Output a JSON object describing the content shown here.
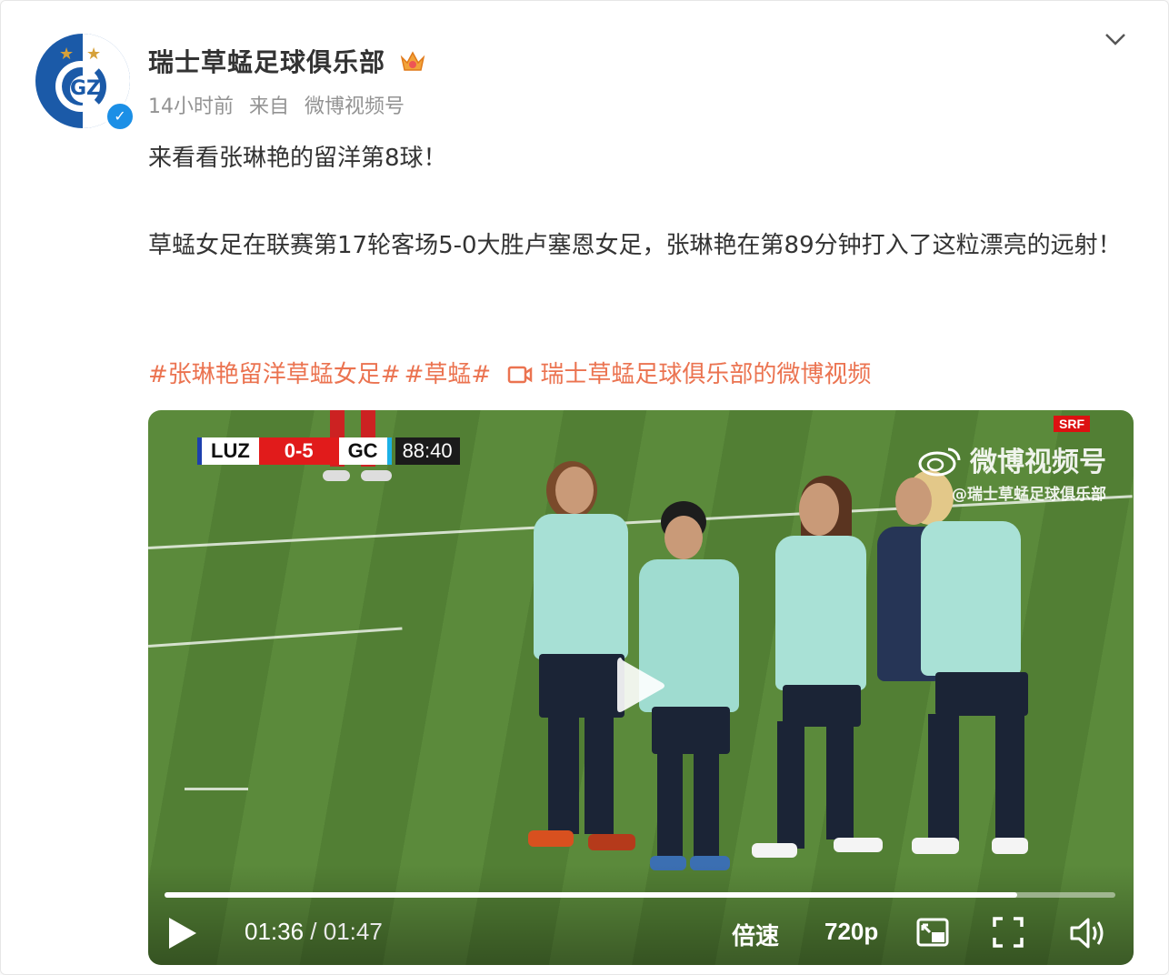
{
  "post": {
    "author": "瑞士草蜢足球俱乐部",
    "meta_time": "14小时前",
    "meta_from": "来自",
    "meta_source": "微博视频号",
    "text_line1": "来看看张琳艳的留洋第8球！",
    "text_line2": "草蜢女足在联赛第17轮客场5-0大胜卢塞恩女足，张琳艳在第89分钟打入了这粒漂亮的远射！",
    "hashtag1": "#张琳艳留洋草蜢女足#",
    "hashtag2": "#草蜢#",
    "video_link": "瑞士草蜢足球俱乐部的微博视频"
  },
  "video": {
    "scoreboard": {
      "home": "LUZ",
      "score": "0-5",
      "away": "GC",
      "clock": "88:40"
    },
    "watermark_main": "微博视频号",
    "watermark_sub": "@瑞士草蜢足球俱乐部",
    "broadcaster": "SRF",
    "current_time": "01:36",
    "separator": " / ",
    "duration": "01:47",
    "progress": 0.897,
    "speed_label": "倍速",
    "quality_label": "720p"
  },
  "icons": [
    "avatar-logo",
    "verified-icon",
    "crown-icon",
    "chevron-down-icon",
    "video-link-icon",
    "weibo-logo-icon",
    "play-icon",
    "pip-icon",
    "fullscreen-icon",
    "volume-icon"
  ],
  "colors": {
    "hashtag": "#eb7350",
    "verified": "#1b8fe6",
    "scoreboard_red": "#e11b1b",
    "pitch": "#5b8a3b"
  }
}
